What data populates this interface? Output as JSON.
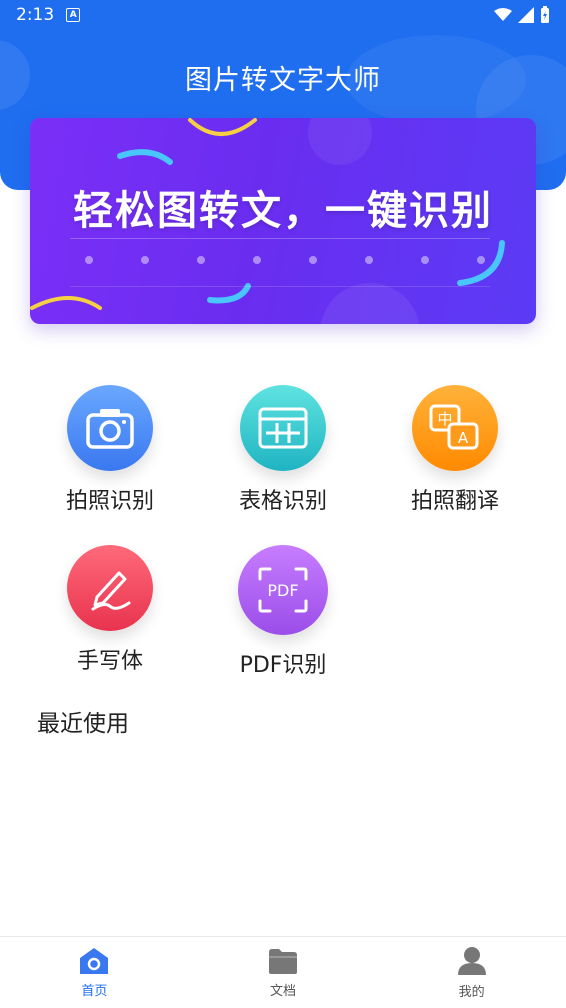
{
  "status_bar": {
    "time": "2:13",
    "app_letter": "A"
  },
  "header": {
    "title": "图片转文字大师"
  },
  "banner": {
    "text": "轻松图转文，一键识别"
  },
  "features": [
    {
      "label": "拍照识别",
      "icon": "camera-icon",
      "color_from": "#6aa8ff",
      "color_to": "#3a78f0"
    },
    {
      "label": "表格识别",
      "icon": "table-icon",
      "color_from": "#5fe3e0",
      "color_to": "#1fb4c2"
    },
    {
      "label": "拍照翻译",
      "icon": "translate-icon",
      "color_from": "#ffb23a",
      "color_to": "#ff8a00"
    },
    {
      "label": "手写体",
      "icon": "pen-icon",
      "color_from": "#ff6a7a",
      "color_to": "#e8334f"
    },
    {
      "label": "PDF识别",
      "icon": "pdf-icon",
      "color_from": "#c77dff",
      "color_to": "#9b4de8"
    }
  ],
  "recent": {
    "title": "最近使用"
  },
  "tabbar": {
    "items": [
      {
        "label": "首页",
        "icon": "home-icon",
        "active": true
      },
      {
        "label": "文档",
        "icon": "folder-icon",
        "active": false
      },
      {
        "label": "我的",
        "icon": "user-icon",
        "active": false
      }
    ]
  },
  "colors": {
    "primary": "#1f6ef0",
    "banner": "#7b2ff7"
  }
}
